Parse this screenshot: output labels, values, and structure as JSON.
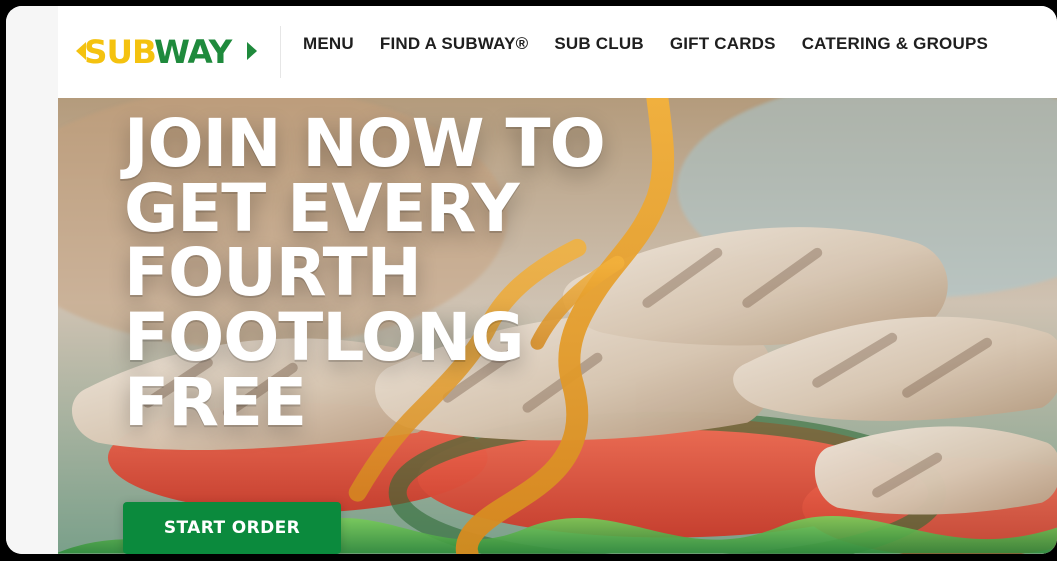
{
  "brand": {
    "logo_sub": "SUB",
    "logo_way": "WAY",
    "colors": {
      "yellow": "#f4c20f",
      "green": "#1f8a3c",
      "button_green": "#0b8a3d"
    }
  },
  "nav": {
    "items": [
      {
        "label": "MENU"
      },
      {
        "label": "FIND A SUBWAY®"
      },
      {
        "label": "SUB CLUB"
      },
      {
        "label": "GIFT CARDS"
      },
      {
        "label": "CATERING & GROUPS"
      }
    ]
  },
  "hero": {
    "heading_lines": [
      "JOIN NOW TO",
      "GET EVERY",
      "FOURTH",
      "FOOTLONG FREE"
    ],
    "cta_label": "START ORDER"
  }
}
